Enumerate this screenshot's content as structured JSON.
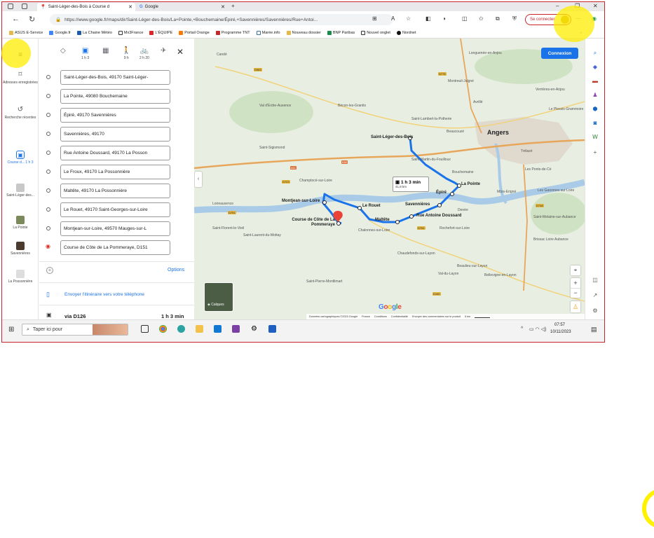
{
  "browser": {
    "tabs": [
      {
        "title": "Saint-Léger-des-Bois à Course d"
      },
      {
        "title": "Google"
      }
    ],
    "new_tab": "+",
    "url": "https://www.google.fr/maps/dir/Saint-Léger-des-Bois/La+Pointe,+Bouchemaine/Épiré,+Savennières/Savennières/Rue+Antoi...",
    "signin_label": "Se connecter",
    "bookmarks": [
      "ASUS E-Service",
      "Google.fr",
      "La Chaine Météo",
      "Mx3France",
      "L'ÉQUIPE",
      "Portail Orange",
      "Programme TNT",
      "Marée.info",
      "Nouveau dossier",
      "BNP Paribas",
      "Nouvel onglet",
      "Nordnet"
    ],
    "colors": {
      "frame": "#c9252c",
      "accent": "#1a73e8",
      "route": "#1a73e8"
    }
  },
  "rail": {
    "items": [
      {
        "icon": "bookmark-icon",
        "label": "Adresses enregistrées"
      },
      {
        "icon": "history-icon",
        "label": "Recherche récentes"
      },
      {
        "icon": "car-icon",
        "label": "Course d... 1 h 3"
      },
      {
        "label": "Saint-Léger-des..."
      },
      {
        "label": "La Pointe"
      },
      {
        "label": "Savennières"
      },
      {
        "label": "La Possonnière"
      }
    ]
  },
  "directions": {
    "modes": [
      {
        "icon": "recommended-icon",
        "time": ""
      },
      {
        "icon": "car-icon",
        "time": "1 h 3"
      },
      {
        "icon": "transit-icon",
        "time": ""
      },
      {
        "icon": "walk-icon",
        "time": "9 h"
      },
      {
        "icon": "bike-icon",
        "time": "2 h 20"
      },
      {
        "icon": "plane-icon",
        "time": ""
      }
    ],
    "stops": [
      "Saint-Léger-des-Bois, 49170 Saint-Léger-",
      "La Pointe, 49080 Bouchemaine",
      "Épiré, 49170 Savennières",
      "Savennières, 49170",
      "Rue Antoine Doussard, 49170 La Posson",
      "Le Froux, 49170 La Possonnière",
      "Maltête, 49170 La Possonnière",
      "Le Rouet, 49170 Saint-Georges-sur-Loire",
      "Montjean-sur-Loire, 49570 Mauges-sur-L",
      "Course de Côte de La Pommeraye, D151"
    ],
    "options_label": "Options",
    "send_label": "Envoyer l'itinéraire vers votre téléphone",
    "route_name": "via D126",
    "route_time": "1 h 3 min"
  },
  "map": {
    "connexion": "Connexion",
    "info_time": "1 h 3 min",
    "info_dist": "41,8 km",
    "layers_label": "Calques",
    "google": "Google",
    "attribution": [
      "Données cartographiques ©2023 Google",
      "France",
      "Conditions",
      "Confidentialité",
      "Envoyer des commentaires sur le produit",
      "5 km"
    ],
    "places_bold": [
      "Saint-Léger-des-Bois",
      "Angers",
      "La Pointe",
      "Épiré",
      "Savennières",
      "Rue Antoine Doussard",
      "Maltête",
      "Le Rouet",
      "Montjean-sur-Loire",
      "Course de Côte de La Pommeraye"
    ],
    "places": [
      "Candé",
      "Longuenée-en-Anjou",
      "Montreuil-Juigné",
      "Verrières-en-Anjou",
      "Val d'Erdre-Auxence",
      "Bécon-les-Granits",
      "Avrillé",
      "Saint-Lambert-la-Potherie",
      "Le Plessis-Grammoire",
      "Beaucouzé",
      "Saint-Sigismond",
      "Saint-Martin-du-Fouilloux",
      "Trélazé",
      "Bouchemaine",
      "Les Ponts-de-Cé",
      "Champtocé-sur-Loire",
      "Mûrs-Erigné",
      "Les Garennes sur Loire",
      "Loireauxence",
      "Denée",
      "Saint-Melaine-sur-Aubance",
      "Rochefort-sur-Loire",
      "Chalonnes-sur-Loire",
      "Brissac Loire Aubance",
      "Chaudefonds-sur-Layon",
      "Beaulieu-sur-Layon",
      "Val-du-Layon",
      "Bellevigne-en-Layon",
      "Saint-Florent-le-Vieil",
      "Saint-Laurent-du-Mottay",
      "Saint-Pierre-Montlimart"
    ],
    "roads": [
      "D963",
      "A11",
      "D723",
      "D751",
      "E60",
      "D748",
      "D160",
      "D775",
      "D761"
    ]
  },
  "taskbar": {
    "search_placeholder": "Taper ici pour",
    "time": "07:57",
    "date": "10/11/2023"
  }
}
